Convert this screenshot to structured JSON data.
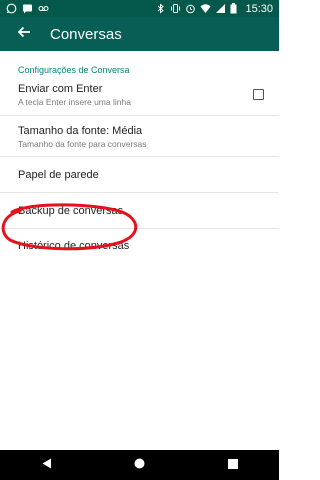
{
  "status_bar": {
    "time": "15:30",
    "icons_left": [
      "whatsapp-icon",
      "message-icon",
      "voicemail-icon"
    ],
    "icons_right": [
      "bluetooth-icon",
      "vibrate-icon",
      "alarm-icon",
      "wifi-icon",
      "signal-icon",
      "battery-icon"
    ]
  },
  "app_bar": {
    "title": "Conversas",
    "back_icon": "back-arrow-icon"
  },
  "settings": {
    "section_header": "Configurações de Conversa",
    "items": [
      {
        "title": "Enviar com Enter",
        "summary": "A tecla Enter insere uma linha",
        "checkbox_checked": false
      },
      {
        "title": "Tamanho da fonte: Média",
        "summary": "Tamanho da fonte para conversas"
      },
      {
        "title": "Papel de parede"
      },
      {
        "title": "Backup de conversas"
      },
      {
        "title": "Histórico de conversas"
      }
    ]
  },
  "annotation": {
    "color": "#e8101a",
    "marks_item": "Backup de conversas"
  },
  "nav_bar": {
    "buttons": [
      "back-triangle-icon",
      "home-circle-icon",
      "recents-square-icon"
    ]
  },
  "colors": {
    "status_bar": "#05594a",
    "app_bar": "#075e54",
    "accent": "#07857a"
  }
}
